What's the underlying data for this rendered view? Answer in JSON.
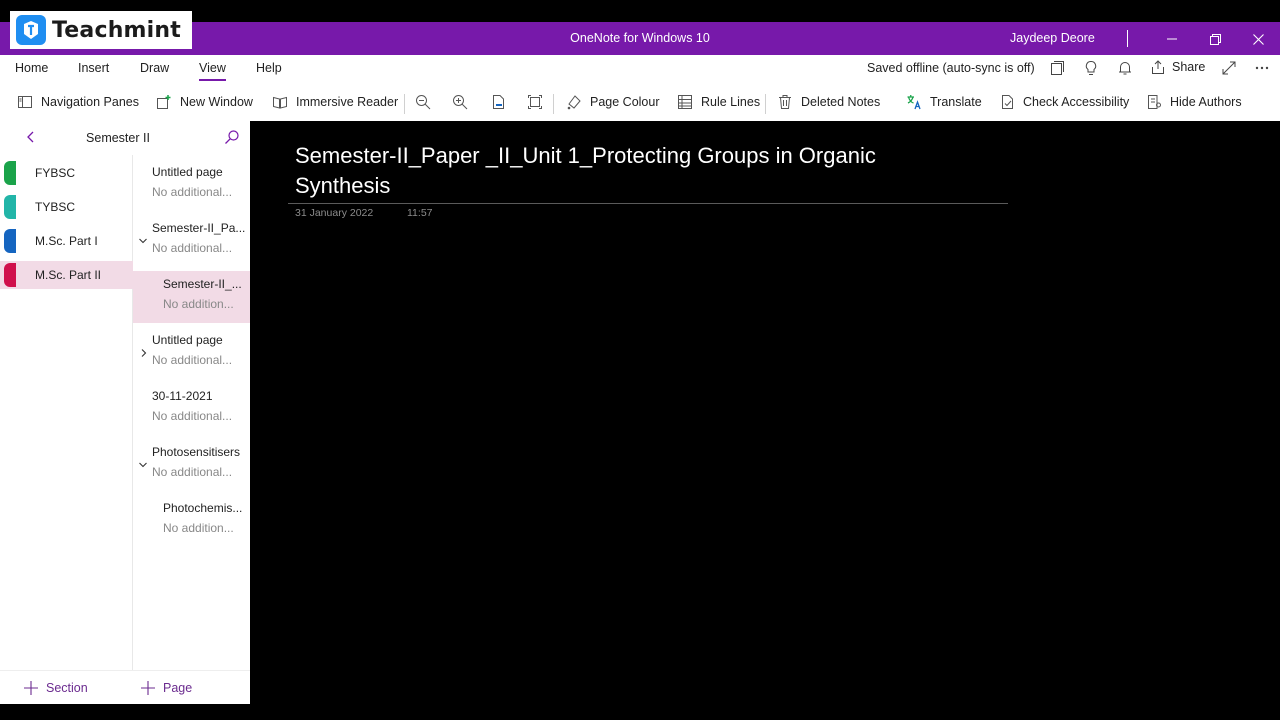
{
  "logo": {
    "name": "Teachmint"
  },
  "window": {
    "title": "OneNote for Windows 10",
    "user": "Jaydeep Deore"
  },
  "tabs": [
    {
      "label": "Home"
    },
    {
      "label": "Insert"
    },
    {
      "label": "Draw"
    },
    {
      "label": "View",
      "active": true
    },
    {
      "label": "Help"
    }
  ],
  "status": "Saved offline (auto-sync is off)",
  "share_label": "Share",
  "toolbar": {
    "navigation_panes": "Navigation Panes",
    "new_window": "New Window",
    "immersive_reader": "Immersive Reader",
    "page_colour": "Page Colour",
    "rule_lines": "Rule Lines",
    "deleted_notes": "Deleted Notes",
    "translate": "Translate",
    "check_accessibility": "Check Accessibility",
    "hide_authors": "Hide Authors"
  },
  "notebook": {
    "current_section": "Semester II"
  },
  "sections": [
    {
      "label": "FYBSC",
      "color": "#1aa34a"
    },
    {
      "label": "TYBSC",
      "color": "#22b5a8"
    },
    {
      "label": "M.Sc. Part I",
      "color": "#1565c0"
    },
    {
      "label": "M.Sc. Part II",
      "color": "#d0104c",
      "active": true
    }
  ],
  "pages": [
    {
      "title": "Untitled page",
      "sub": "No additional..."
    },
    {
      "title": "Semester-II_Pa...",
      "sub": "No additional..."
    },
    {
      "title": "Semester-II_...",
      "sub": "No addition..."
    },
    {
      "title": "Untitled page",
      "sub": "No additional..."
    },
    {
      "title": "30-11-2021",
      "sub": "No additional..."
    },
    {
      "title": "Photosensitisers",
      "sub": "No additional..."
    },
    {
      "title": "Photochemis...",
      "sub": "No addition..."
    }
  ],
  "add_section": "Section",
  "add_page": "Page",
  "note": {
    "title": "Semester-II_Paper _II_Unit 1_Protecting Groups in Organic Synthesis",
    "date": "31 January 2022",
    "time": "11:57"
  },
  "colors": {
    "accent": "#7719aa",
    "selected": "#f2dbe6"
  }
}
